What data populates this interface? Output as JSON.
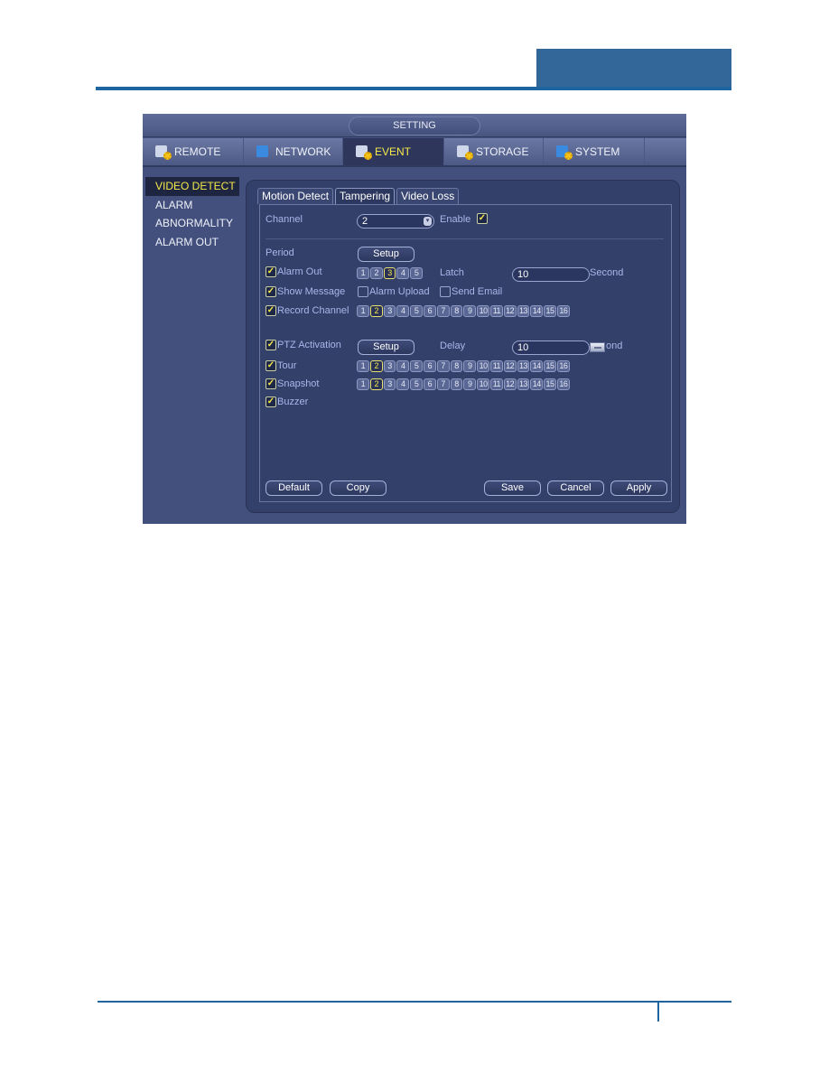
{
  "window": {
    "title": "SETTING"
  },
  "main_tabs": [
    {
      "label": "REMOTE",
      "icon": "remote-icon",
      "active": false
    },
    {
      "label": "NETWORK",
      "icon": "network-icon",
      "active": false
    },
    {
      "label": "EVENT",
      "icon": "event-icon",
      "active": true
    },
    {
      "label": "STORAGE",
      "icon": "storage-icon",
      "active": false
    },
    {
      "label": "SYSTEM",
      "icon": "system-icon",
      "active": false
    }
  ],
  "sidebar": {
    "items": [
      {
        "label": "VIDEO DETECT",
        "active": true
      },
      {
        "label": "ALARM",
        "active": false
      },
      {
        "label": "ABNORMALITY",
        "active": false
      },
      {
        "label": "ALARM OUT",
        "active": false
      }
    ]
  },
  "sub_tabs": [
    {
      "label": "Motion Detect",
      "active": false
    },
    {
      "label": "Tampering",
      "active": true
    },
    {
      "label": "Video Loss",
      "active": false
    }
  ],
  "form": {
    "channel_label": "Channel",
    "channel_value": "2",
    "enable_label": "Enable",
    "enable_checked": true,
    "period_label": "Period",
    "setup_label": "Setup",
    "alarm_out": {
      "label": "Alarm Out",
      "checked": true,
      "channels": [
        "1",
        "2",
        "3",
        "4",
        "5"
      ],
      "selected": [
        "3"
      ]
    },
    "latch_label": "Latch",
    "latch_value": "10",
    "latch_unit": "Second",
    "show_message": {
      "label": "Show Message",
      "checked": true
    },
    "alarm_upload": {
      "label": "Alarm Upload",
      "checked": false
    },
    "send_email": {
      "label": "Send Email",
      "checked": false
    },
    "record_channel": {
      "label": "Record Channel",
      "checked": true,
      "selected": [
        "2"
      ]
    },
    "ptz_activation": {
      "label": "PTZ Activation",
      "checked": true
    },
    "ptz_setup_label": "Setup",
    "delay_label": "Delay",
    "delay_value": "10",
    "delay_unit": "ond",
    "tour": {
      "label": "Tour",
      "checked": true,
      "selected": [
        "2"
      ]
    },
    "snapshot": {
      "label": "Snapshot",
      "checked": true,
      "selected": [
        "2"
      ]
    },
    "buzzer": {
      "label": "Buzzer",
      "checked": true
    },
    "channels16": [
      "1",
      "2",
      "3",
      "4",
      "5",
      "6",
      "7",
      "8",
      "9",
      "10",
      "11",
      "12",
      "13",
      "14",
      "15",
      "16"
    ]
  },
  "buttons": {
    "default": "Default",
    "copy": "Copy",
    "save": "Save",
    "cancel": "Cancel",
    "apply": "Apply"
  },
  "colors": {
    "accent_yellow": "#f5e94a",
    "doc_blue": "#336699",
    "panel_bg": "#33406a"
  }
}
